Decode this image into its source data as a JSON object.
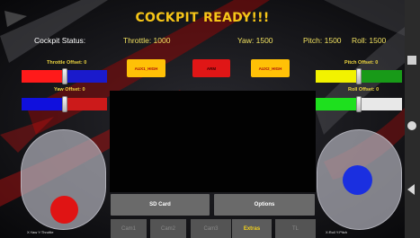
{
  "title": "COCKPIT READY!!!",
  "status": {
    "label": "Cockpit Status:",
    "throttle": "Throttle: 1000",
    "yaw": "Yaw: 1500",
    "pitch": "Pitch: 1500",
    "roll": "Roll: 1500"
  },
  "offsets": {
    "throttle": {
      "label": "Throttle Offset: 0",
      "value_fraction": 0.5,
      "fill_color": "#ff1a1a",
      "track_color": "#1a1acc"
    },
    "yaw": {
      "label": "Yaw Offset: 0",
      "value_fraction": 0.5,
      "fill_color": "#1010dd",
      "track_color": "#cc1a1a"
    },
    "pitch": {
      "label": "Pitch Offset: 0",
      "value_fraction": 0.5,
      "fill_color": "#f2f200",
      "track_color": "#189a18"
    },
    "roll": {
      "label": "Roll Offset: 0",
      "value_fraction": 0.5,
      "fill_color": "#1ee01e",
      "track_color": "#e8e8e8"
    }
  },
  "aux_buttons": [
    "AUX1_HIGH",
    "ARM",
    "AUX2_HIGH"
  ],
  "bottom_buttons": {
    "sd_card": "SD Card",
    "options": "Options"
  },
  "tabs": [
    {
      "label": "Cam1",
      "active": false
    },
    {
      "label": "Cam2",
      "active": false
    },
    {
      "label": "Cam3",
      "active": false
    },
    {
      "label": "Extras",
      "active": true
    },
    {
      "label": "TL",
      "active": false
    }
  ],
  "joysticks": {
    "left_label": "X:Yaw Y:Throttle",
    "right_label": "X:Roll Y:Pitch"
  },
  "colors": {
    "accent": "#f5c518",
    "aux_button": "#ffc107",
    "arm_button": "#e01616",
    "left_knob": "#e01414",
    "right_knob": "#1a2fe0"
  },
  "nav_icons": [
    "square-icon",
    "circle-icon",
    "back-triangle-icon"
  ]
}
